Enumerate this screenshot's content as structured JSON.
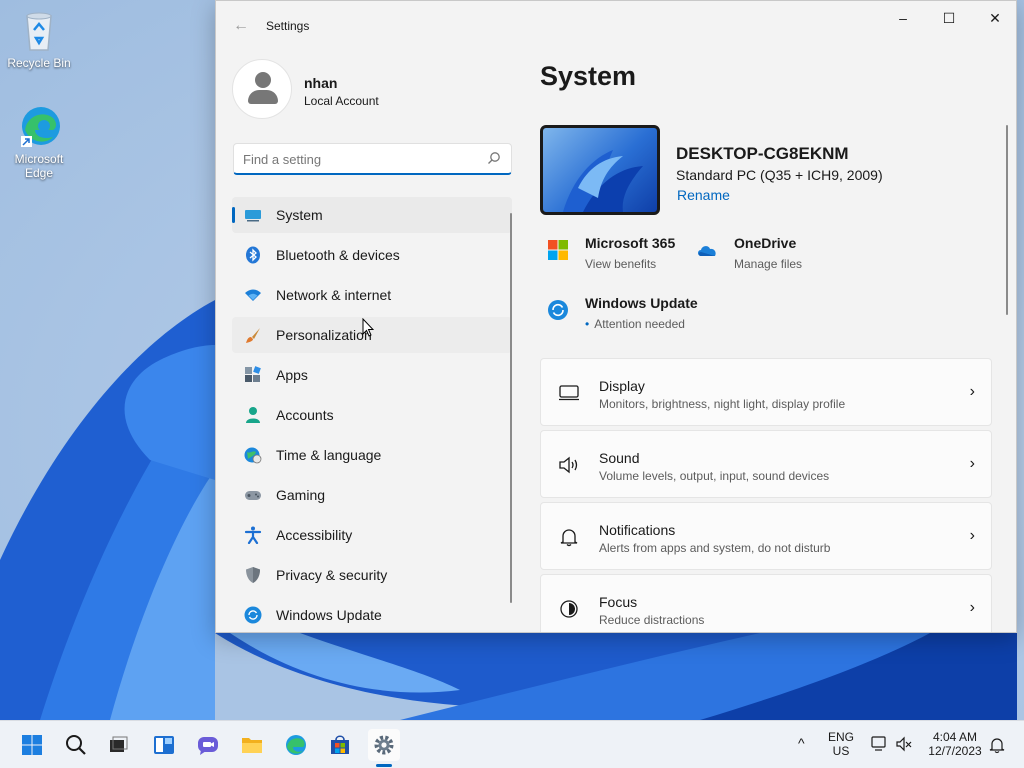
{
  "desktop": {
    "icons": [
      {
        "label": "Recycle Bin",
        "icon": "recycle-bin-icon"
      },
      {
        "label": "Microsoft Edge",
        "icon": "edge-icon"
      }
    ]
  },
  "window": {
    "title": "Settings",
    "back_icon": "back-arrow-icon",
    "controls": {
      "minimize": "–",
      "maximize": "☐",
      "close": "✕"
    }
  },
  "profile": {
    "name": "nhan",
    "account_type": "Local Account"
  },
  "search": {
    "placeholder": "Find a setting",
    "value": ""
  },
  "nav": {
    "items": [
      {
        "label": "System",
        "icon": "system-monitor-icon",
        "selected": true
      },
      {
        "label": "Bluetooth & devices",
        "icon": "bluetooth-icon"
      },
      {
        "label": "Network & internet",
        "icon": "wifi-icon"
      },
      {
        "label": "Personalization",
        "icon": "paintbrush-icon"
      },
      {
        "label": "Apps",
        "icon": "apps-icon"
      },
      {
        "label": "Accounts",
        "icon": "accounts-icon"
      },
      {
        "label": "Time & language",
        "icon": "globe-clock-icon"
      },
      {
        "label": "Gaming",
        "icon": "gamepad-icon"
      },
      {
        "label": "Accessibility",
        "icon": "accessibility-icon"
      },
      {
        "label": "Privacy & security",
        "icon": "shield-icon"
      },
      {
        "label": "Windows Update",
        "icon": "update-icon"
      }
    ]
  },
  "main": {
    "title": "System",
    "device": {
      "name": "DESKTOP-CG8EKNM",
      "model": "Standard PC (Q35 + ICH9, 2009)",
      "rename": "Rename"
    },
    "quick_links": [
      {
        "title": "Microsoft 365",
        "subtitle": "View benefits",
        "icon": "microsoft-logo-icon"
      },
      {
        "title": "OneDrive",
        "subtitle": "Manage files",
        "icon": "onedrive-cloud-icon"
      },
      {
        "title": "Windows Update",
        "subtitle": "Attention needed",
        "icon": "update-icon",
        "dot": "•"
      }
    ],
    "cards": [
      {
        "title": "Display",
        "subtitle": "Monitors, brightness, night light, display profile",
        "icon": "display-icon"
      },
      {
        "title": "Sound",
        "subtitle": "Volume levels, output, input, sound devices",
        "icon": "speaker-icon"
      },
      {
        "title": "Notifications",
        "subtitle": "Alerts from apps and system, do not disturb",
        "icon": "bell-icon"
      },
      {
        "title": "Focus",
        "subtitle": "Reduce distractions",
        "icon": "focus-icon"
      }
    ],
    "chevron": "›"
  },
  "taskbar": {
    "apps": [
      "start-icon",
      "search-icon",
      "task-view-icon",
      "widgets-icon",
      "chat-icon",
      "file-explorer-icon",
      "edge-icon",
      "store-icon",
      "settings-gear-icon"
    ],
    "tray": {
      "chevron": "^",
      "lang_top": "ENG",
      "lang_bottom": "US",
      "time": "4:04 AM",
      "date": "12/7/2023"
    }
  },
  "colors": {
    "accent": "#0067c0",
    "window_bg": "#f3f3f3"
  }
}
